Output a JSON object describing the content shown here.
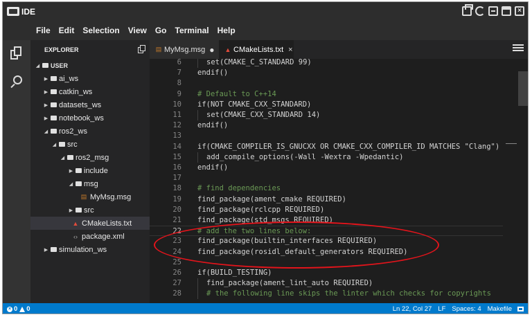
{
  "window": {
    "title": "IDE"
  },
  "menu": [
    "File",
    "Edit",
    "Selection",
    "View",
    "Go",
    "Terminal",
    "Help"
  ],
  "sidebar": {
    "title": "EXPLORER",
    "tree": [
      {
        "label": "USER",
        "kind": "root",
        "depth": 0,
        "expanded": true
      },
      {
        "label": "ai_ws",
        "kind": "folder",
        "depth": 1,
        "expanded": false
      },
      {
        "label": "catkin_ws",
        "kind": "folder",
        "depth": 1,
        "expanded": false
      },
      {
        "label": "datasets_ws",
        "kind": "folder",
        "depth": 1,
        "expanded": false
      },
      {
        "label": "notebook_ws",
        "kind": "folder",
        "depth": 1,
        "expanded": false
      },
      {
        "label": "ros2_ws",
        "kind": "folder",
        "depth": 1,
        "expanded": true
      },
      {
        "label": "src",
        "kind": "folder",
        "depth": 2,
        "expanded": true
      },
      {
        "label": "ros2_msg",
        "kind": "folder",
        "depth": 3,
        "expanded": true
      },
      {
        "label": "include",
        "kind": "folder",
        "depth": 4,
        "expanded": false
      },
      {
        "label": "msg",
        "kind": "folder",
        "depth": 4,
        "expanded": true
      },
      {
        "label": "MyMsg.msg",
        "kind": "msg",
        "depth": 5
      },
      {
        "label": "src",
        "kind": "folder",
        "depth": 4,
        "expanded": false
      },
      {
        "label": "CMakeLists.txt",
        "kind": "cmake",
        "depth": 4,
        "selected": true
      },
      {
        "label": "package.xml",
        "kind": "xml",
        "depth": 4
      },
      {
        "label": "simulation_ws",
        "kind": "folder",
        "depth": 1,
        "expanded": false
      }
    ]
  },
  "tabs": [
    {
      "label": "MyMsg.msg",
      "modified": true,
      "active": false
    },
    {
      "label": "CMakeLists.txt",
      "modified": false,
      "active": true
    }
  ],
  "editor": {
    "lines": [
      {
        "n": "6",
        "text": "set(CMAKE_C_STANDARD 99)",
        "indent": 1
      },
      {
        "n": "7",
        "text": "endif()",
        "indent": 0
      },
      {
        "n": "8",
        "text": "",
        "indent": 0
      },
      {
        "n": "9",
        "text": "# Default to C++14",
        "indent": 0,
        "comment": true
      },
      {
        "n": "10",
        "text": "if(NOT CMAKE_CXX_STANDARD)",
        "indent": 0
      },
      {
        "n": "11",
        "text": "set(CMAKE_CXX_STANDARD 14)",
        "indent": 1
      },
      {
        "n": "12",
        "text": "endif()",
        "indent": 0
      },
      {
        "n": "13",
        "text": "",
        "indent": 0
      },
      {
        "n": "14",
        "text": "if(CMAKE_COMPILER_IS_GNUCXX OR CMAKE_CXX_COMPILER_ID MATCHES \"Clang\")",
        "indent": 0
      },
      {
        "n": "15",
        "text": "add_compile_options(-Wall -Wextra -Wpedantic)",
        "indent": 1
      },
      {
        "n": "16",
        "text": "endif()",
        "indent": 0
      },
      {
        "n": "17",
        "text": "",
        "indent": 0
      },
      {
        "n": "18",
        "text": "# find dependencies",
        "indent": 0,
        "comment": true
      },
      {
        "n": "19",
        "text": "find_package(ament_cmake REQUIRED)",
        "indent": 0
      },
      {
        "n": "20",
        "text": "find_package(rclcpp REQUIRED)",
        "indent": 0
      },
      {
        "n": "21",
        "text": "find_package(std_msgs REQUIRED)",
        "indent": 0
      },
      {
        "n": "22",
        "text": "# add the two lines below:",
        "indent": 0,
        "comment": true,
        "current": true
      },
      {
        "n": "23",
        "text": "find_package(builtin_interfaces REQUIRED)",
        "indent": 0
      },
      {
        "n": "24",
        "text": "find_package(rosidl_default_generators REQUIRED)",
        "indent": 0
      },
      {
        "n": "25",
        "text": "",
        "indent": 0
      },
      {
        "n": "26",
        "text": "if(BUILD_TESTING)",
        "indent": 0
      },
      {
        "n": "27",
        "text": "find_package(ament_lint_auto REQUIRED)",
        "indent": 1
      },
      {
        "n": "28",
        "text": "# the following line skips the linter which checks for copyrights",
        "indent": 1,
        "comment": true
      }
    ]
  },
  "statusbar": {
    "errors": "0",
    "warnings": "0",
    "position": "Ln 22, Col 27",
    "eol": "LF",
    "spaces": "Spaces: 4",
    "language": "Makefile"
  },
  "colors": {
    "accent": "#007acc",
    "annotation": "#e3141b",
    "comment": "#6a9955"
  }
}
